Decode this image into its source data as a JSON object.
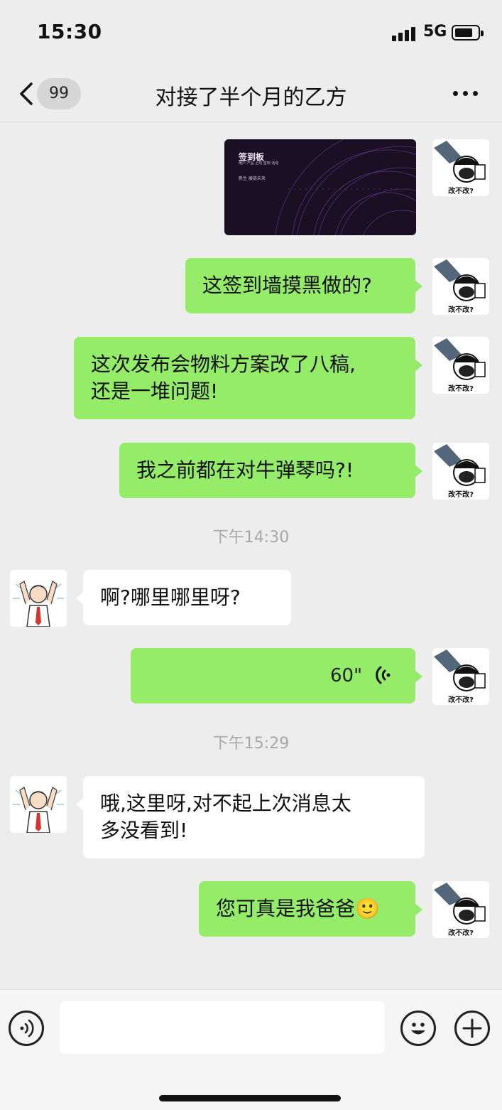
{
  "status_bar": {
    "time": "15:30",
    "network": "5G"
  },
  "header": {
    "unread_count": "99",
    "title": "对接了半个月的乙方"
  },
  "avatars": {
    "me_caption": "改不改?"
  },
  "image_message": {
    "title": "签到板",
    "subtitle": "用户 产品 上线 签到 活动",
    "tagline": "新生 展链未来"
  },
  "messages": {
    "m1": "这签到墙摸黑做的?",
    "m2_line1": "这次发布会物料方案改了八稿,",
    "m2_line2": "还是一堆问题!",
    "m3": "我之前都在对牛弹琴吗?!",
    "ts1": "下午14:30",
    "m4": "啊?哪里哪里呀?",
    "voice_duration": "60\"",
    "ts2": "下午15:29",
    "m5_line1": "哦,这里呀,对不起上次消息太",
    "m5_line2": "多没看到!",
    "m6": "您可真是我爸爸🙂"
  },
  "input_bar": {
    "placeholder": ""
  },
  "colors": {
    "my_bubble": "#95ec69",
    "their_bubble": "#ffffff",
    "background": "#ededed"
  }
}
